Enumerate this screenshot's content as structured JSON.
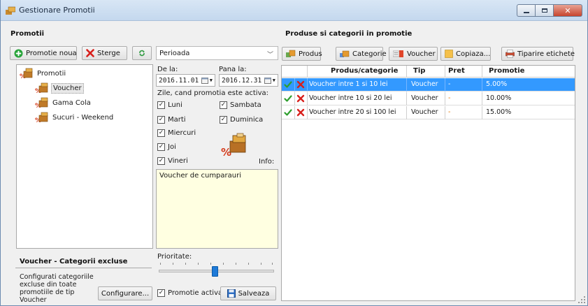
{
  "window": {
    "title": "Gestionare Promotii"
  },
  "left": {
    "section_title": "Promotii",
    "add_button": "Promotie noua",
    "delete_button": "Sterge",
    "tree": {
      "root": "Promotii",
      "children": [
        "Voucher",
        "Gama Cola",
        "Sucuri - Weekend"
      ],
      "selected": "Voucher"
    },
    "excluded_title": "Voucher - Categorii excluse",
    "excluded_text": "Configurati categoriile excluse din toate promotiile de tip Voucher",
    "config_button": "Configurare..."
  },
  "middle": {
    "period_select": "Perioada",
    "start_label": "De la:",
    "end_label": "Pana la:",
    "start_date": "2016.11.01",
    "end_date": "2016.12.31",
    "days_label": "Zile, cand promotia este activa:",
    "days": {
      "luni": "Luni",
      "marti": "Marti",
      "miercuri": "Miercuri",
      "joi": "Joi",
      "vineri": "Vineri",
      "sambata": "Sambata",
      "duminica": "Duminica"
    },
    "days_checked": true,
    "info_label": "Info:",
    "info_text": "Voucher de cumparauri",
    "priority_label": "Prioritate:",
    "priority_level": 0.5,
    "active_label": "Promotie activa",
    "save_button": "Salveaza"
  },
  "right": {
    "section_title": "Produse si categorii in promotie",
    "toolbar": {
      "product": "Produs",
      "category": "Categorie",
      "voucher": "Voucher",
      "copy": "Copiaza...",
      "print": "Tiparire etichete"
    },
    "columns": {
      "name": "Produs/categorie",
      "type": "Tip",
      "price": "Pret",
      "promo": "Promotie"
    },
    "rows": [
      {
        "name": "Voucher intre 1 si 10 lei",
        "type": "Voucher",
        "price": "-",
        "promo": "5.00%"
      },
      {
        "name": "Voucher intre 10 si 20 lei",
        "type": "Voucher",
        "price": "-",
        "promo": "10.00%"
      },
      {
        "name": "Voucher intre 20 si 100 lei",
        "type": "Voucher",
        "price": "-",
        "promo": "15.00%"
      }
    ],
    "selected_row": 0
  },
  "colors": {
    "selection": "#3399ff",
    "info_background": "#ffffe1",
    "check_green": "#2e9e2e",
    "delete_red": "#d8201c"
  }
}
